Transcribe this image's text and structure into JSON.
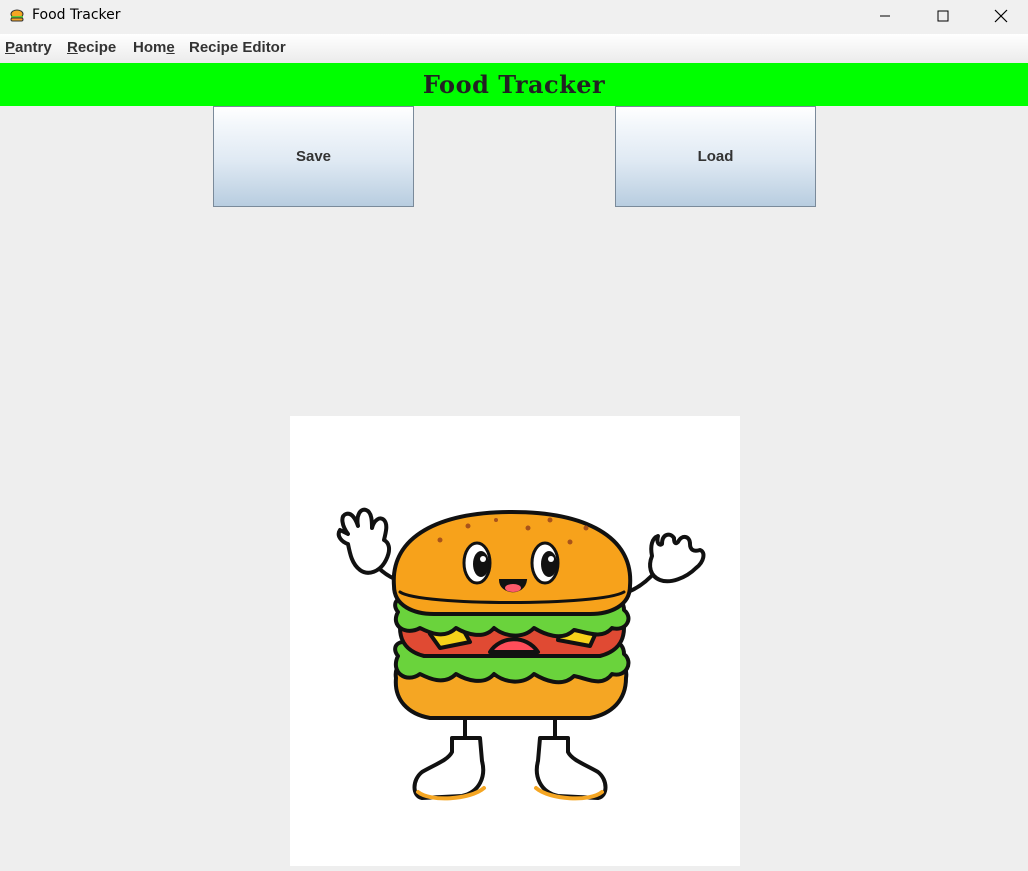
{
  "window": {
    "title": "Food Tracker",
    "app_icon": "burger-app-icon",
    "controls": [
      "minimize-icon",
      "maximize-icon",
      "close-icon"
    ]
  },
  "menu": {
    "items": [
      {
        "mnemonic": "P",
        "rest": "antry"
      },
      {
        "mnemonic": "R",
        "rest": "ecipe"
      },
      {
        "pre": "Hom",
        "mnemonic": "e"
      },
      {
        "label": "Recipe Editor"
      }
    ]
  },
  "header": {
    "title": "Food Tracker",
    "bg_color": "#00ff00"
  },
  "buttons": {
    "save_label": "Save",
    "load_label": "Load"
  },
  "image": {
    "subject": "burger-mascot-illustration"
  }
}
